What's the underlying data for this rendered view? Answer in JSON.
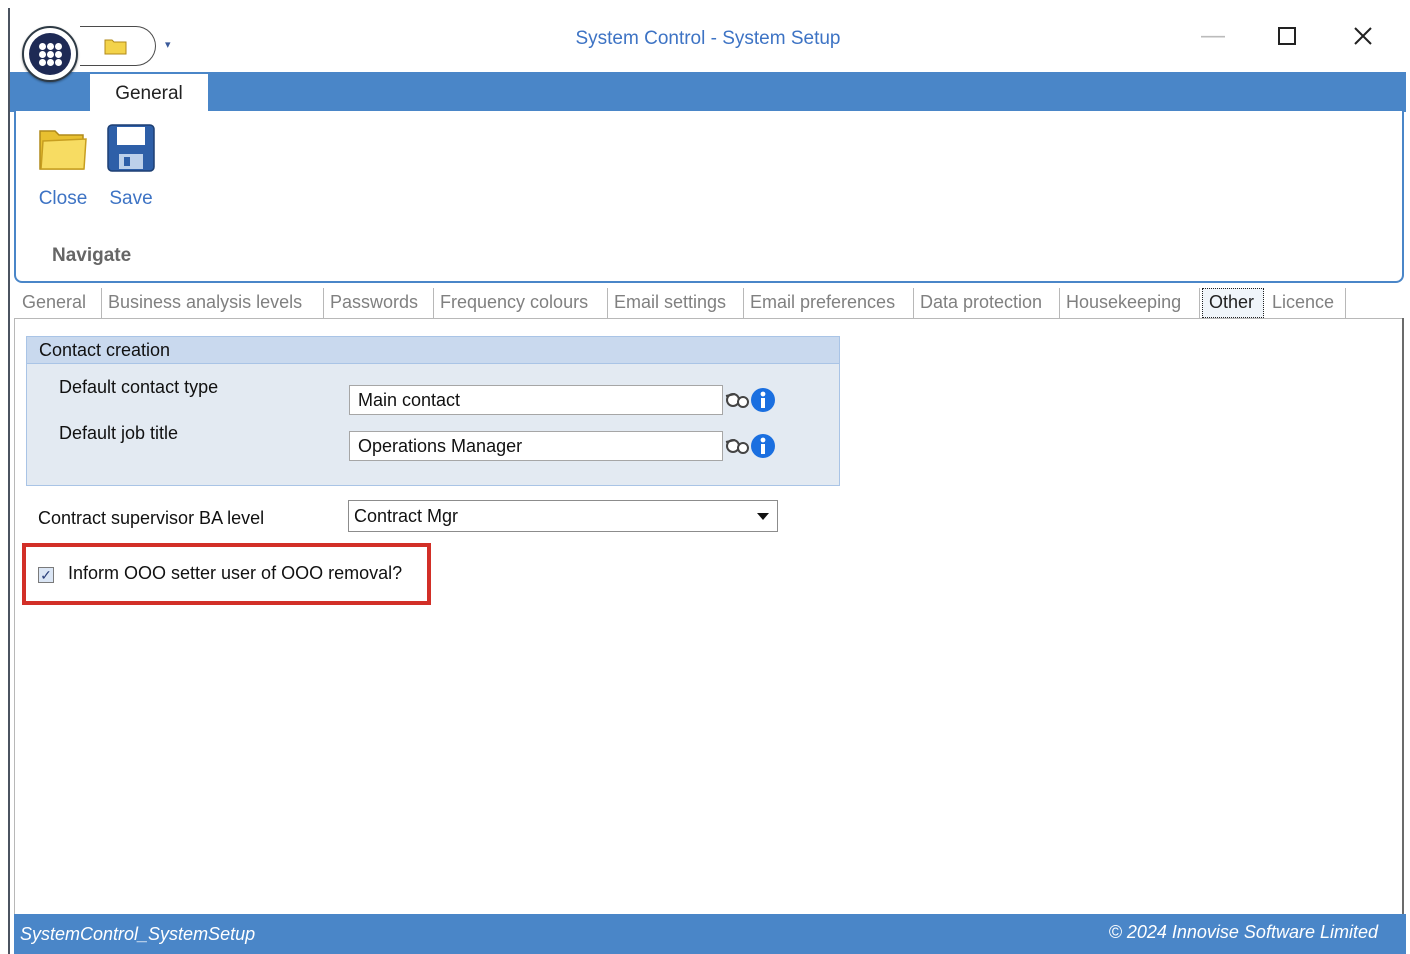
{
  "window": {
    "title": "System Control - System Setup",
    "minimize_icon": "minimize-icon",
    "maximize_icon": "maximize-icon",
    "close_icon": "close-icon"
  },
  "ribbon": {
    "tab": "General",
    "buttons": [
      {
        "label": "Close",
        "icon": "folder-icon"
      },
      {
        "label": "Save",
        "icon": "floppy-disk-icon"
      }
    ],
    "group_label": "Navigate"
  },
  "tabs": [
    {
      "label": "General",
      "active": false
    },
    {
      "label": "Business analysis levels",
      "active": false
    },
    {
      "label": "Passwords",
      "active": false
    },
    {
      "label": "Frequency colours",
      "active": false
    },
    {
      "label": "Email settings",
      "active": false
    },
    {
      "label": "Email preferences",
      "active": false
    },
    {
      "label": "Data protection",
      "active": false
    },
    {
      "label": "Housekeeping",
      "active": false
    },
    {
      "label": "Other",
      "active": true
    },
    {
      "label": "Licence",
      "active": false
    }
  ],
  "contact_creation": {
    "header": "Contact creation",
    "default_contact_type": {
      "label": "Default contact type",
      "value": "Main contact"
    },
    "default_job_title": {
      "label": "Default job title",
      "value": "Operations Manager"
    }
  },
  "contract_supervisor": {
    "label": "Contract supervisor BA level",
    "value": "Contract Mgr"
  },
  "inform_checkbox": {
    "label": "Inform OOO setter user of OOO removal?",
    "checked": true
  },
  "status": {
    "left": "SystemControl_SystemSetup",
    "right": "© 2024 Innovise Software Limited"
  },
  "colors": {
    "accent": "#4a86c8",
    "title_text": "#3d73c4",
    "highlight": "#d22f27"
  }
}
